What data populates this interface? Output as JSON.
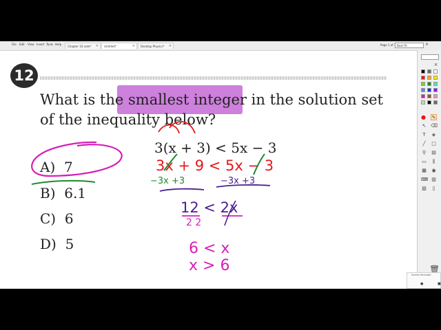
{
  "menu": [
    "File",
    "Edit",
    "View",
    "Insert",
    "Tools",
    "Help"
  ],
  "tabs": [
    {
      "label": "Chapter 10.note*",
      "active": false
    },
    {
      "label": "Untitled*",
      "active": true
    },
    {
      "label": "Desktop Physics*",
      "active": false
    }
  ],
  "page_indicator": "Page 1 of 1",
  "zoom": "Best Fit",
  "question": {
    "number": "12",
    "text_before": "What is the",
    "highlighted": "smallest integer",
    "text_after": "in the solution set of the inequality below?",
    "equation": "3(x + 3) < 5x − 3"
  },
  "choices": [
    {
      "letter": "A)",
      "value": "7",
      "circled": true,
      "crossed": false
    },
    {
      "letter": "B)",
      "value": "6.1",
      "circled": false,
      "crossed": true
    },
    {
      "letter": "C)",
      "value": "6",
      "circled": false,
      "crossed": false
    },
    {
      "letter": "D)",
      "value": "5",
      "circled": false,
      "crossed": false
    }
  ],
  "handwriting": {
    "line1": "3x + 9 < 5x − 3",
    "line2_left": "−3x  +3",
    "line2_right": "−3x  +3",
    "line3": "12 < 2x",
    "line3_divisors": "2      2",
    "line4": "6 < x",
    "line5": "x > 6"
  },
  "colors": {
    "highlight": "#c46ad6",
    "ink_red": "#e8161b",
    "ink_green": "#1f8a2e",
    "ink_purple": "#4b1f8f",
    "ink_magenta": "#d61fb7"
  },
  "toolbar_swatches": [
    "#000000",
    "#6b6b6b",
    "#ffffff",
    "#e8161b",
    "#f5a623",
    "#ffe600",
    "#7ed321",
    "#1f8a2e",
    "#50e3c2",
    "#4a90e2",
    "#1f2ad6",
    "#9013fe",
    "#d61fb7",
    "#8b572a",
    "#ff8fb1",
    "#b8e986",
    "#000000",
    "#6b6b6b"
  ],
  "recorder_label": "Screen Recorder"
}
